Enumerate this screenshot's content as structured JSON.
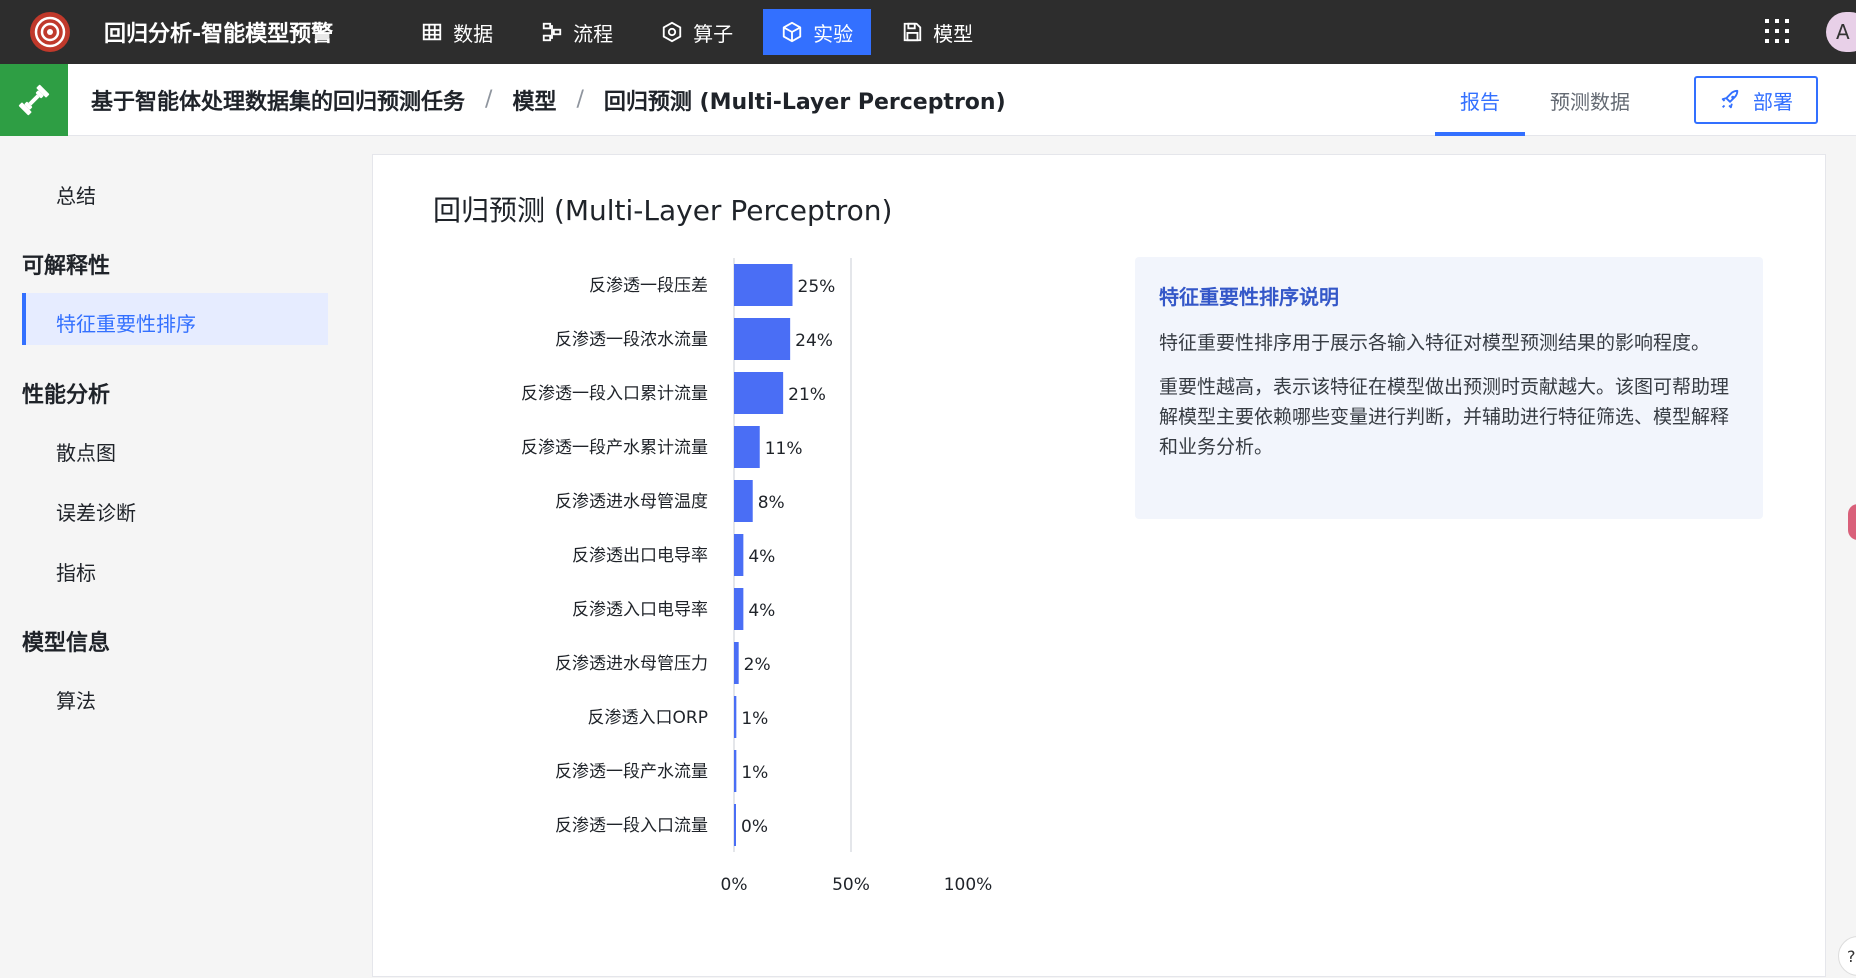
{
  "app": {
    "title": "回归分析-智能模型预警",
    "avatar_initial": "A"
  },
  "nav": {
    "items": [
      {
        "label": "数据",
        "icon": "table-icon"
      },
      {
        "label": "流程",
        "icon": "flow-icon"
      },
      {
        "label": "算子",
        "icon": "operator-icon"
      },
      {
        "label": "实验",
        "icon": "cube-icon",
        "active": true
      },
      {
        "label": "模型",
        "icon": "save-icon"
      }
    ]
  },
  "breadcrumb": {
    "items": [
      "基于智能体处理数据集的回归预测任务",
      "模型",
      "回归预测 (Multi-Layer Perceptron)"
    ],
    "separator": "/"
  },
  "tabs": [
    {
      "label": "报告",
      "active": true
    },
    {
      "label": "预测数据",
      "active": false
    }
  ],
  "deploy_button": {
    "label": "部署"
  },
  "sidebar": {
    "summary": "总结",
    "groups": [
      {
        "title": "可解释性",
        "items": [
          {
            "label": "特征重要性排序",
            "active": true
          }
        ]
      },
      {
        "title": "性能分析",
        "items": [
          {
            "label": "散点图"
          },
          {
            "label": "误差诊断"
          },
          {
            "label": "指标"
          }
        ]
      },
      {
        "title": "模型信息",
        "items": [
          {
            "label": "算法"
          }
        ]
      }
    ]
  },
  "main": {
    "title": "回归预测 (Multi-Layer Perceptron)",
    "info": {
      "title": "特征重要性排序说明",
      "paragraphs": [
        "特征重要性排序用于展示各输入特征对模型预测结果的影响程度。",
        "重要性越高，表示该特征在模型做出预测时贡献越大。该图可帮助理解模型主要依赖哪些变量进行判断，并辅助进行特征筛选、模型解释和业务分析。"
      ]
    }
  },
  "chart_data": {
    "type": "bar",
    "orientation": "horizontal",
    "categories": [
      "反渗透一段压差",
      "反渗透一段浓水流量",
      "反渗透一段入口累计流量",
      "反渗透一段产水累计流量",
      "反渗透进水母管温度",
      "反渗透出口电导率",
      "反渗透入口电导率",
      "反渗透进水母管压力",
      "反渗透入口ORP",
      "反渗透一段产水流量",
      "反渗透一段入口流量"
    ],
    "values": [
      25,
      24,
      21,
      11,
      8,
      4,
      4,
      2,
      1,
      1,
      0
    ],
    "value_labels": [
      "25%",
      "24%",
      "21%",
      "11%",
      "8%",
      "4%",
      "4%",
      "2%",
      "1%",
      "1%",
      "0%"
    ],
    "x_ticks": [
      "0%",
      "50%",
      "100%"
    ],
    "xlim": [
      0,
      100
    ],
    "title": "",
    "xlabel": "",
    "ylabel": "",
    "bar_color": "#4a6ef5",
    "grid": "x-axis 50% reference line"
  },
  "colors": {
    "accent": "#3370ff",
    "topbar": "#2d2d2d",
    "feature_badge": "#2e9e44"
  }
}
